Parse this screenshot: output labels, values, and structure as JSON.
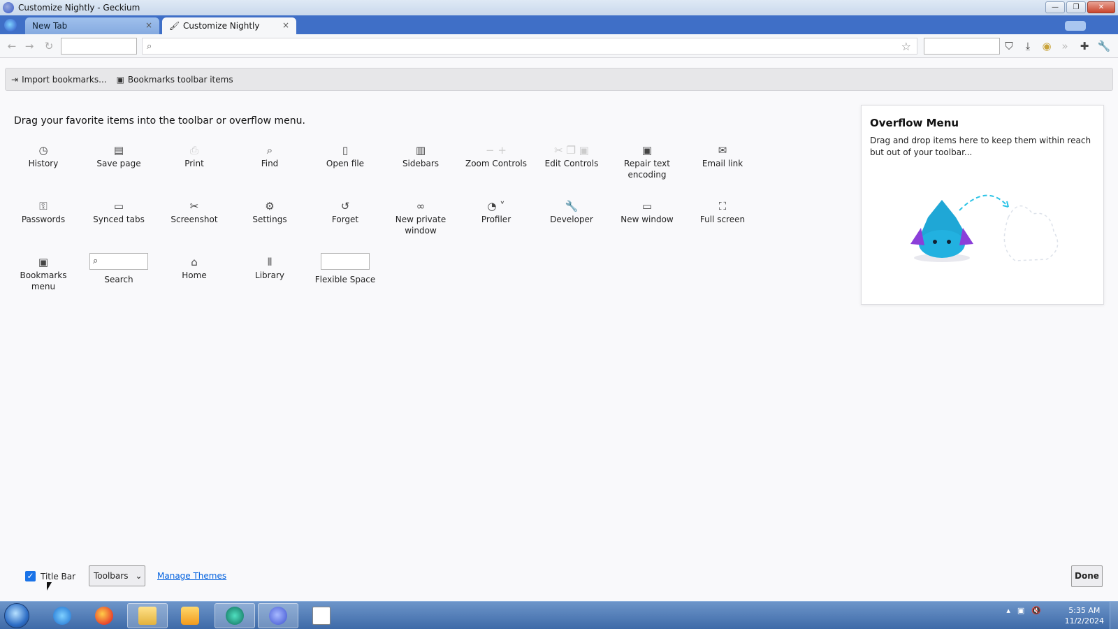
{
  "window": {
    "title": "Customize Nightly - Geckium",
    "minimize_label": "—",
    "restore_label": "❐",
    "close_label": "✕"
  },
  "tabs": [
    {
      "label": "New Tab",
      "close": "×",
      "active": false
    },
    {
      "label": "Customize Nightly",
      "close": "×",
      "active": true
    }
  ],
  "navbar": {
    "back": "←",
    "forward": "→",
    "reload": "↻",
    "url_value": "",
    "search_value": "",
    "star": "☆"
  },
  "bookmarks_bar": {
    "import_label": "Import bookmarks...",
    "toolbar_items_label": "Bookmarks toolbar items"
  },
  "palette": {
    "instructions": "Drag your favorite items into the toolbar or overflow menu.",
    "items": [
      {
        "label": "History",
        "icon": "history-icon",
        "glyph": "◷"
      },
      {
        "label": "Save page",
        "icon": "save-page-icon",
        "glyph": "▤"
      },
      {
        "label": "Print",
        "icon": "print-icon",
        "glyph": "⎙"
      },
      {
        "label": "Find",
        "icon": "find-icon",
        "glyph": "⌕"
      },
      {
        "label": "Open file",
        "icon": "open-file-icon",
        "glyph": "▯"
      },
      {
        "label": "Sidebars",
        "icon": "sidebars-icon",
        "glyph": "▥"
      },
      {
        "label": "Zoom Controls",
        "icon": "zoom-controls-icon",
        "glyph": "−  +"
      },
      {
        "label": "Edit Controls",
        "icon": "edit-controls-icon",
        "glyph": "✂ ❐ ▣"
      },
      {
        "label": "Repair text encoding",
        "icon": "repair-text-encoding-icon",
        "glyph": "▣"
      },
      {
        "label": "Email link",
        "icon": "email-link-icon",
        "glyph": "✉"
      },
      {
        "label": "Passwords",
        "icon": "passwords-icon",
        "glyph": "⚿"
      },
      {
        "label": "Synced tabs",
        "icon": "synced-tabs-icon",
        "glyph": "▭"
      },
      {
        "label": "Screenshot",
        "icon": "screenshot-icon",
        "glyph": "✂"
      },
      {
        "label": "Settings",
        "icon": "settings-icon",
        "glyph": "⚙"
      },
      {
        "label": "Forget",
        "icon": "forget-icon",
        "glyph": "↺"
      },
      {
        "label": "New private window",
        "icon": "private-window-icon",
        "glyph": "∞"
      },
      {
        "label": "Profiler",
        "icon": "profiler-icon",
        "glyph": "◔ ˅"
      },
      {
        "label": "Developer",
        "icon": "developer-icon",
        "glyph": "🔧"
      },
      {
        "label": "New window",
        "icon": "new-window-icon",
        "glyph": "▭"
      },
      {
        "label": "Full screen",
        "icon": "full-screen-icon",
        "glyph": "⛶"
      },
      {
        "label": "Bookmarks menu",
        "icon": "bookmarks-menu-icon",
        "glyph": "▣"
      },
      {
        "label": "Search",
        "icon": "search-icon",
        "glyph": "⌕"
      },
      {
        "label": "Home",
        "icon": "home-icon",
        "glyph": "⌂"
      },
      {
        "label": "Library",
        "icon": "library-icon",
        "glyph": "⫴"
      },
      {
        "label": "Flexible Space",
        "icon": "flexible-space-icon",
        "glyph": ""
      }
    ]
  },
  "overflow": {
    "title": "Overflow Menu",
    "description": "Drag and drop items here to keep them within reach but out of your toolbar..."
  },
  "footer": {
    "title_bar_label": "Title Bar",
    "title_bar_checked": true,
    "toolbars_label": "Toolbars",
    "manage_themes_label": "Manage Themes",
    "done_label": "Done"
  },
  "taskbar": {
    "time": "5:35 AM",
    "date": "11/2/2024"
  },
  "colors": {
    "tabstrip": "#3f6fc7",
    "link": "#0060df",
    "checkbox": "#1a73e8"
  }
}
